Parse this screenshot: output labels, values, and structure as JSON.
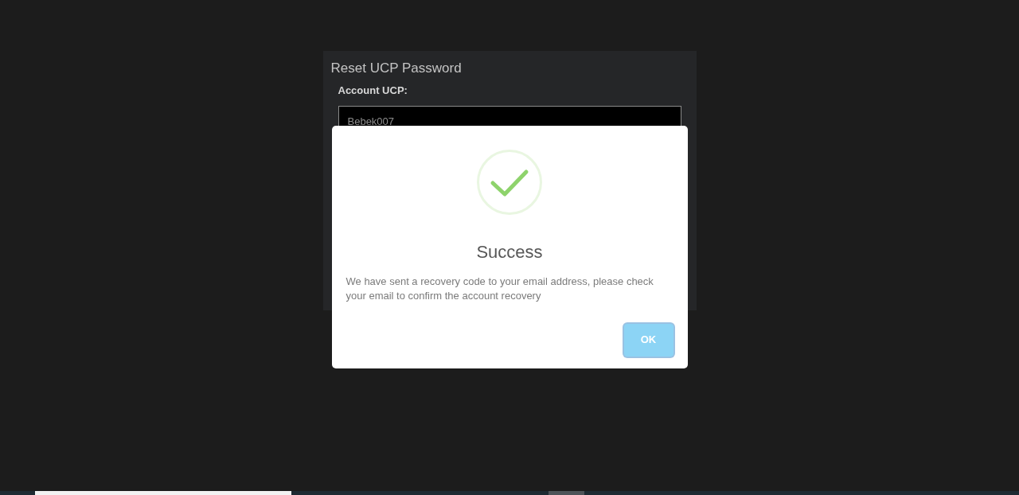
{
  "panel": {
    "title": "Reset UCP Password",
    "field": {
      "label": "Account UCP:",
      "value": "Bebek007"
    }
  },
  "dialog": {
    "title": "Success",
    "message": "We have sent a recovery code to your email address, please check your email to confirm the account recovery",
    "buttons": [
      {
        "label": "OK",
        "focused": true
      }
    ]
  }
}
